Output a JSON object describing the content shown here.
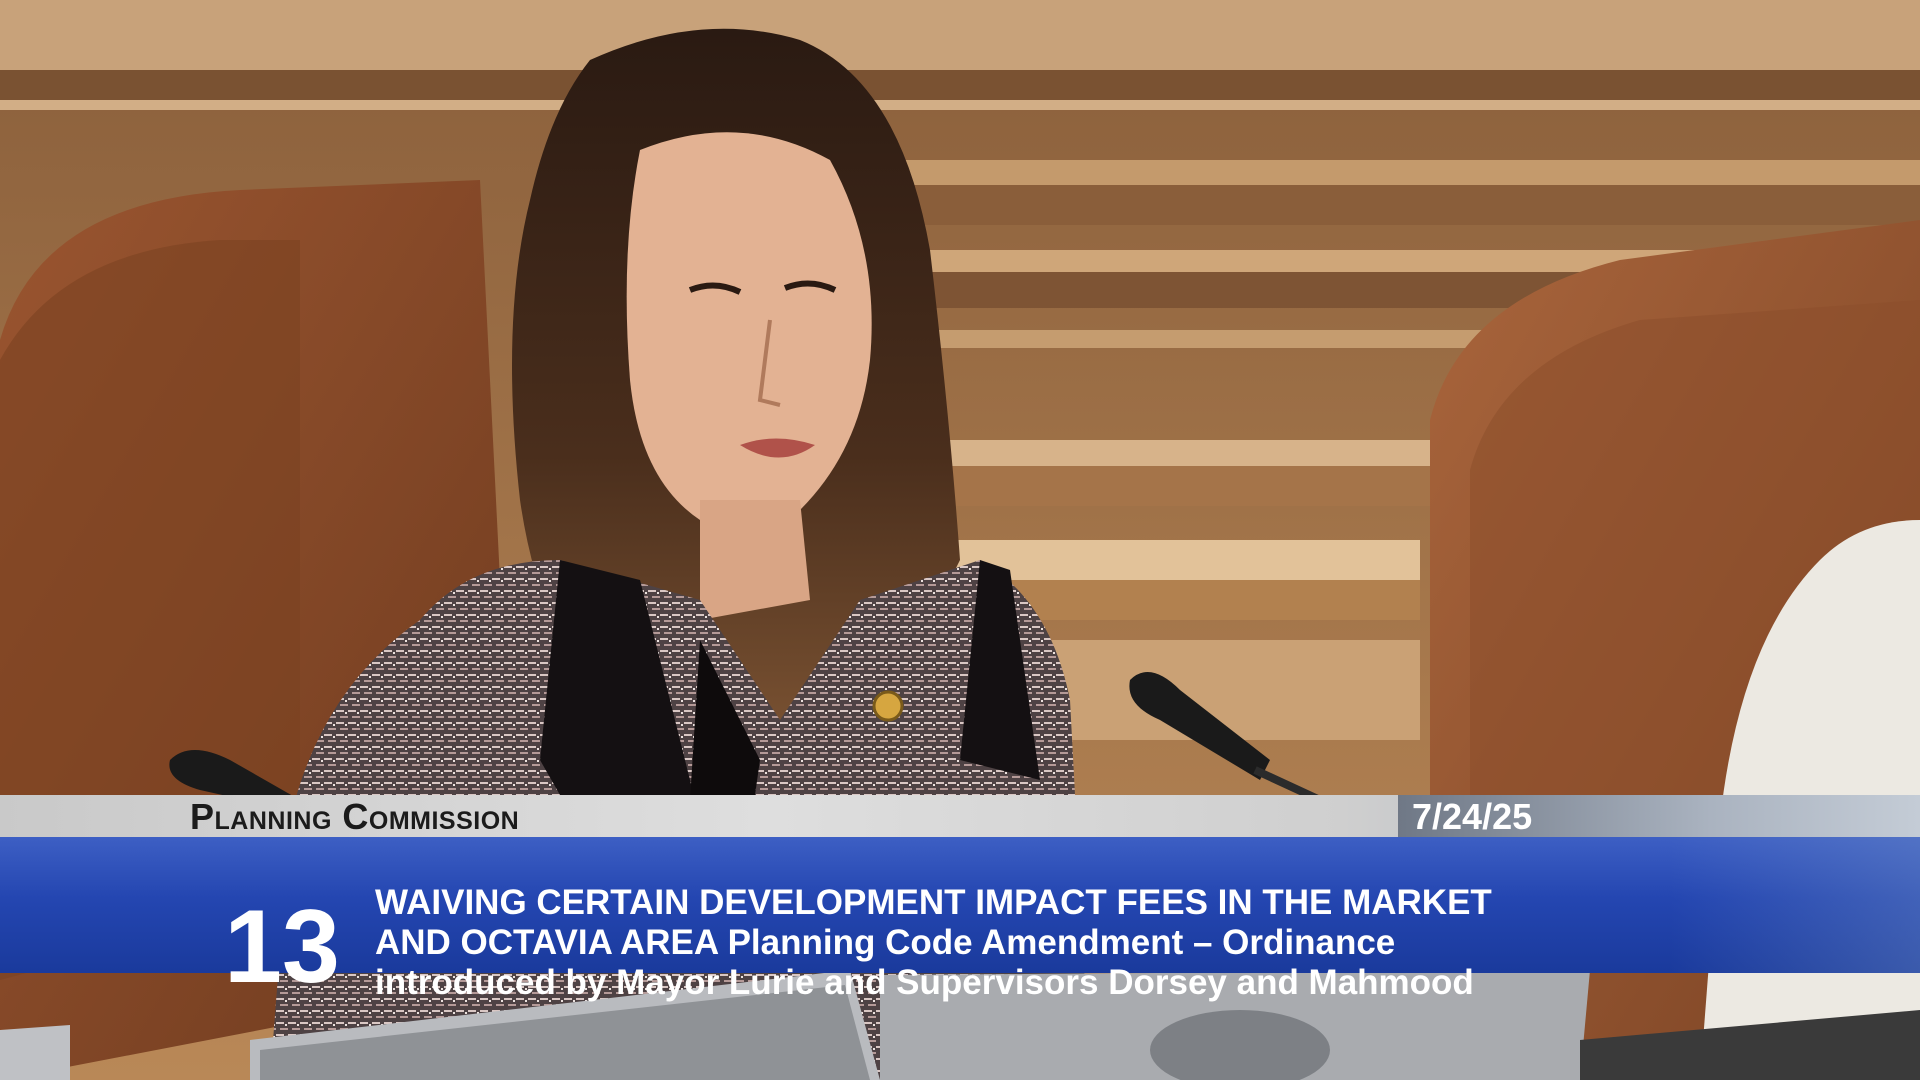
{
  "lower_third": {
    "commission": "Planning Commission",
    "date": "7/24/25",
    "item_number": "13",
    "lines": [
      "WAIVING CERTAIN DEVELOPMENT IMPACT FEES IN THE MARKET",
      "AND OCTAVIA AREA  Planning Code Amendment – Ordinance",
      "introduced by Mayor Lurie and Supervisors Dorsey and Mahmood"
    ]
  },
  "colors": {
    "agenda_bar": "#2446b1",
    "title_bar": "#d6d6d6",
    "wood": "#a8754a",
    "leather": "#8b4a2a"
  }
}
